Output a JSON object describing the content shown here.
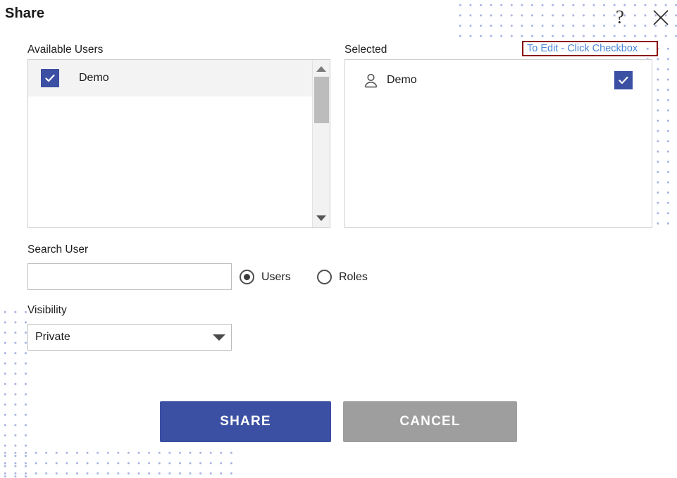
{
  "dialog": {
    "title": "Share",
    "help_icon": "question-mark-icon",
    "close_icon": "close-x-icon"
  },
  "available_users": {
    "label": "Available Users",
    "items": [
      {
        "name": "Demo",
        "checked": true
      }
    ],
    "scrollbar": {
      "up_arrow": "chevron-up-icon",
      "down_arrow": "chevron-down-icon"
    }
  },
  "selected": {
    "label": "Selected",
    "edit_hint": "To Edit - Click Checkbox",
    "items": [
      {
        "name": "Demo",
        "checked": true,
        "icon": "person-icon"
      }
    ]
  },
  "search": {
    "label": "Search User",
    "value": "",
    "placeholder": "",
    "radios": [
      {
        "label": "Users",
        "selected": true
      },
      {
        "label": "Roles",
        "selected": false
      }
    ]
  },
  "visibility": {
    "label": "Visibility",
    "value": "Private",
    "caret_icon": "caret-down-icon",
    "options": [
      "Private"
    ]
  },
  "actions": {
    "share_label": "SHARE",
    "cancel_label": "CANCEL"
  },
  "colors": {
    "accent_blue": "#3b50a2",
    "cancel_gray": "#9e9e9e",
    "hint_border_red": "#8b0000",
    "hint_link_blue": "#4a86d8",
    "dot_pattern": "#aab4e2"
  }
}
